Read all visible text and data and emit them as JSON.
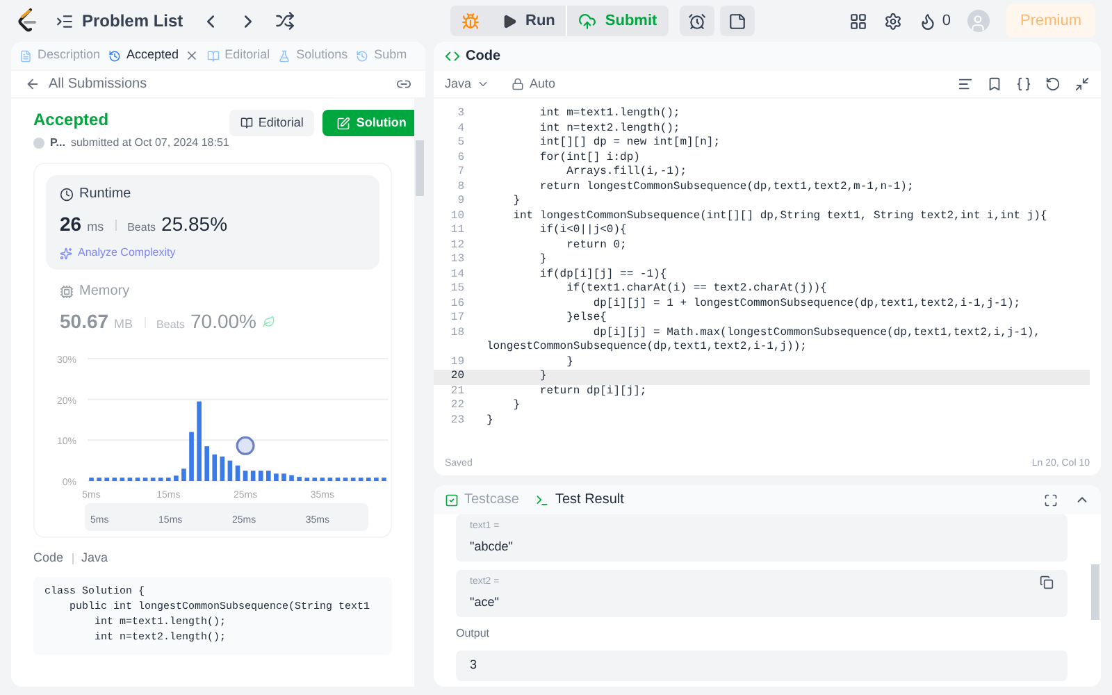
{
  "topbar": {
    "problem_list": "Problem List",
    "run": "Run",
    "submit": "Submit",
    "streak": "0",
    "premium": "Premium"
  },
  "left_tabs": [
    {
      "label": "Description",
      "selected": false,
      "closable": false
    },
    {
      "label": "Accepted",
      "selected": true,
      "closable": true
    },
    {
      "label": "Editorial",
      "selected": false,
      "closable": false
    },
    {
      "label": "Solutions",
      "selected": false,
      "closable": false
    },
    {
      "label": "Subm",
      "selected": false,
      "closable": false
    }
  ],
  "back_link": "All Submissions",
  "submission": {
    "status": "Accepted",
    "user": "P...",
    "submitted": "submitted at Oct 07, 2024 18:51",
    "editorial_button": "Editorial",
    "solution_button": "Solution"
  },
  "metrics": [
    {
      "kind": "runtime",
      "title": "Runtime",
      "value": "26",
      "unit": "ms",
      "beats_label": "Beats",
      "beats": "25.85%",
      "analyze": "Analyze Complexity",
      "selected": true
    },
    {
      "kind": "memory",
      "title": "Memory",
      "value": "50.67",
      "unit": "MB",
      "beats_label": "Beats",
      "beats": "70.00%",
      "selected": false
    }
  ],
  "chart_data": {
    "type": "bar",
    "x": [
      5,
      6,
      7,
      8,
      9,
      10,
      11,
      12,
      13,
      14,
      15,
      16,
      17,
      18,
      19,
      20,
      21,
      22,
      23,
      24,
      25,
      26,
      27,
      28,
      29,
      30,
      31,
      32,
      33,
      34,
      35,
      36,
      37,
      38,
      39,
      40,
      41,
      42,
      43
    ],
    "xlim": [
      4.5,
      43.5
    ],
    "series": [
      {
        "color": "#3b7be8",
        "values": [
          0.8,
          0.8,
          0.8,
          0.8,
          0.8,
          0.8,
          0.8,
          0.8,
          0.8,
          0.8,
          0.8,
          1.3,
          3,
          12,
          19.5,
          8.5,
          6.5,
          6,
          5,
          3.8,
          2.5,
          2.5,
          2.5,
          2.5,
          1.8,
          1.8,
          1.4,
          1,
          0.8,
          0.8,
          0.8,
          0.8,
          0.8,
          0.8,
          0.8,
          0.8,
          0.8,
          0.8,
          0.8
        ]
      }
    ],
    "xticks": [
      {
        "value": 5,
        "label": "5ms"
      },
      {
        "value": 15,
        "label": "15ms"
      },
      {
        "value": 25,
        "label": "25ms"
      },
      {
        "value": 35,
        "label": "35ms"
      }
    ],
    "yticks": [
      {
        "value": 0,
        "label": "0%"
      },
      {
        "value": 10,
        "label": "10%"
      },
      {
        "value": 20,
        "label": "20%"
      },
      {
        "value": 30,
        "label": "30%"
      }
    ],
    "ylim": [
      0,
      30
    ]
  },
  "navigator_labels": [
    "5ms",
    "15ms",
    "25ms",
    "35ms"
  ],
  "code_section": {
    "label": "Code",
    "language": "Java"
  },
  "left_code": [
    "class Solution {",
    "    public int longestCommonSubsequence(String text1",
    "        int m=text1.length();",
    "        int n=text2.length();"
  ],
  "editor": {
    "title": "Code",
    "language": "Java",
    "mode": "Auto",
    "status": "Saved",
    "cursor": "Ln 20, Col 10",
    "lines": [
      {
        "number": "3",
        "text": "        int m=text1.length();",
        "current": false
      },
      {
        "number": "4",
        "text": "        int n=text2.length();",
        "current": false
      },
      {
        "number": "5",
        "text": "        int[][] dp = new int[m][n];",
        "current": false
      },
      {
        "number": "6",
        "text": "        for(int[] i:dp)",
        "current": false
      },
      {
        "number": "7",
        "text": "            Arrays.fill(i,-1);",
        "current": false
      },
      {
        "number": "8",
        "text": "        return longestCommonSubsequence(dp,text1,text2,m-1,n-1);",
        "current": false
      },
      {
        "number": "9",
        "text": "    }",
        "current": false
      },
      {
        "number": "10",
        "text": "    int longestCommonSubsequence(int[][] dp,String text1, String text2,int i,int j){",
        "current": false
      },
      {
        "number": "11",
        "text": "        if(i<0||j<0){",
        "current": false
      },
      {
        "number": "12",
        "text": "            return 0;",
        "current": false
      },
      {
        "number": "13",
        "text": "        }",
        "current": false
      },
      {
        "number": "14",
        "text": "        if(dp[i][j] == -1){",
        "current": false
      },
      {
        "number": "15",
        "text": "            if(text1.charAt(i) == text2.charAt(j)){",
        "current": false
      },
      {
        "number": "16",
        "text": "                dp[i][j] = 1 + longestCommonSubsequence(dp,text1,text2,i-1,j-1);",
        "current": false
      },
      {
        "number": "17",
        "text": "            }else{",
        "current": false
      },
      {
        "number": "18",
        "text": "                dp[i][j] = Math.max(longestCommonSubsequence(dp,text1,text2,i,j-1), longestCommonSubsequence(dp,text1,text2,i-1,j));",
        "current": false
      },
      {
        "number": "19",
        "text": "            }",
        "current": false
      },
      {
        "number": "20",
        "text": "        }",
        "current": true
      },
      {
        "number": "21",
        "text": "        return dp[i][j];",
        "current": false
      },
      {
        "number": "22",
        "text": "    }",
        "current": false
      },
      {
        "number": "23",
        "text": "}",
        "current": false
      }
    ]
  },
  "test_tabs": [
    {
      "label": "Testcase",
      "kind": "testcase",
      "selected": false
    },
    {
      "label": "Test Result",
      "kind": "result",
      "selected": true
    }
  ],
  "inputs": [
    {
      "label": "text1 =",
      "value": "\"abcde\"",
      "copyable": false
    },
    {
      "label": "text2 =",
      "value": "\"ace\"",
      "copyable": true
    }
  ],
  "output": {
    "label": "Output",
    "value": "3"
  }
}
